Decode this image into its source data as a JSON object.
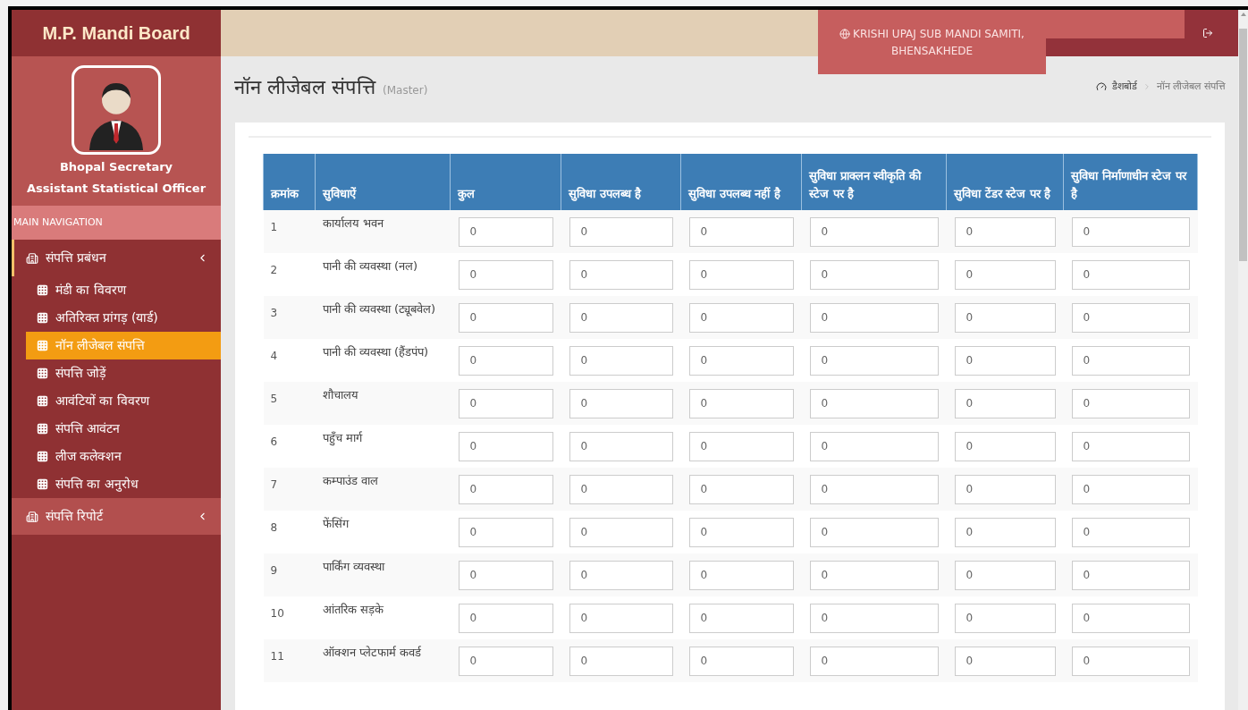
{
  "app": {
    "title": "M.P. Mandi Board"
  },
  "user": {
    "name": "Bhopal Secretary",
    "role": "Assistant Statistical Officer"
  },
  "sidebar": {
    "heading": "MAIN NAVIGATION",
    "items": [
      {
        "label": "संपत्ति प्रबंधन",
        "expanded": true,
        "children": [
          {
            "label": "मंडी का विवरण",
            "selected": false
          },
          {
            "label": "अतिरिक्त प्रांगड़ (यार्ड)",
            "selected": false
          },
          {
            "label": "नॉन लीजेबल संपत्ति",
            "selected": true
          },
          {
            "label": "संपत्ति जोड़ें",
            "selected": false
          },
          {
            "label": "आवंटियों का विवरण",
            "selected": false
          },
          {
            "label": "संपत्ति आवंटन",
            "selected": false
          },
          {
            "label": "लीज कलेक्शन",
            "selected": false
          },
          {
            "label": "संपत्ति का अनुरोध",
            "selected": false
          }
        ]
      },
      {
        "label": "संपत्ति रिपोर्ट",
        "expanded": false
      }
    ]
  },
  "header": {
    "location": "KRISHI UPAJ SUB MANDI SAMITI, BHENSAKHEDE"
  },
  "page": {
    "title": "नॉन लीजेबल संपत्ति",
    "subtitle": "(Master)",
    "breadcrumb": [
      "डैशबोर्ड",
      "नॉन लीजेबल संपत्ति"
    ]
  },
  "table": {
    "columns": [
      "क्रमांक",
      "सुविधाऐं",
      "कुल",
      "सुविधा उपलब्ध है",
      "सुविधा उपलब्ध नहीं है",
      "सुविधा प्राक्लन स्वीकृति की स्टेज पर है",
      "सुविधा टेंडर स्टेज पर है",
      "सुविधा निर्माणाधीन स्टेज पर है"
    ],
    "rows": [
      {
        "number": "1",
        "facility": "कार्यालय भवन",
        "values": [
          "0",
          "0",
          "0",
          "0",
          "0",
          "0"
        ]
      },
      {
        "number": "2",
        "facility": "पानी की व्यवस्था (नल)",
        "values": [
          "0",
          "0",
          "0",
          "0",
          "0",
          "0"
        ]
      },
      {
        "number": "3",
        "facility": "पानी की व्यवस्था (ट्यूबवेल)",
        "values": [
          "0",
          "0",
          "0",
          "0",
          "0",
          "0"
        ]
      },
      {
        "number": "4",
        "facility": "पानी की व्यवस्था (हैंडपंप)",
        "values": [
          "0",
          "0",
          "0",
          "0",
          "0",
          "0"
        ]
      },
      {
        "number": "5",
        "facility": "शौचालय",
        "values": [
          "0",
          "0",
          "0",
          "0",
          "0",
          "0"
        ]
      },
      {
        "number": "6",
        "facility": "पहुँच मार्ग",
        "values": [
          "0",
          "0",
          "0",
          "0",
          "0",
          "0"
        ]
      },
      {
        "number": "7",
        "facility": "कम्पाउंड वाल",
        "values": [
          "0",
          "0",
          "0",
          "0",
          "0",
          "0"
        ]
      },
      {
        "number": "8",
        "facility": "फेंसिंग",
        "values": [
          "0",
          "0",
          "0",
          "0",
          "0",
          "0"
        ]
      },
      {
        "number": "9",
        "facility": "पार्किंग व्यवस्था",
        "values": [
          "0",
          "0",
          "0",
          "0",
          "0",
          "0"
        ]
      },
      {
        "number": "10",
        "facility": "आंतरिक सड़के",
        "values": [
          "0",
          "0",
          "0",
          "0",
          "0",
          "0"
        ]
      },
      {
        "number": "11",
        "facility": "ऑक्शन प्लेटफार्म कवर्ड",
        "values": [
          "0",
          "0",
          "0",
          "0",
          "0",
          "0"
        ]
      }
    ]
  }
}
